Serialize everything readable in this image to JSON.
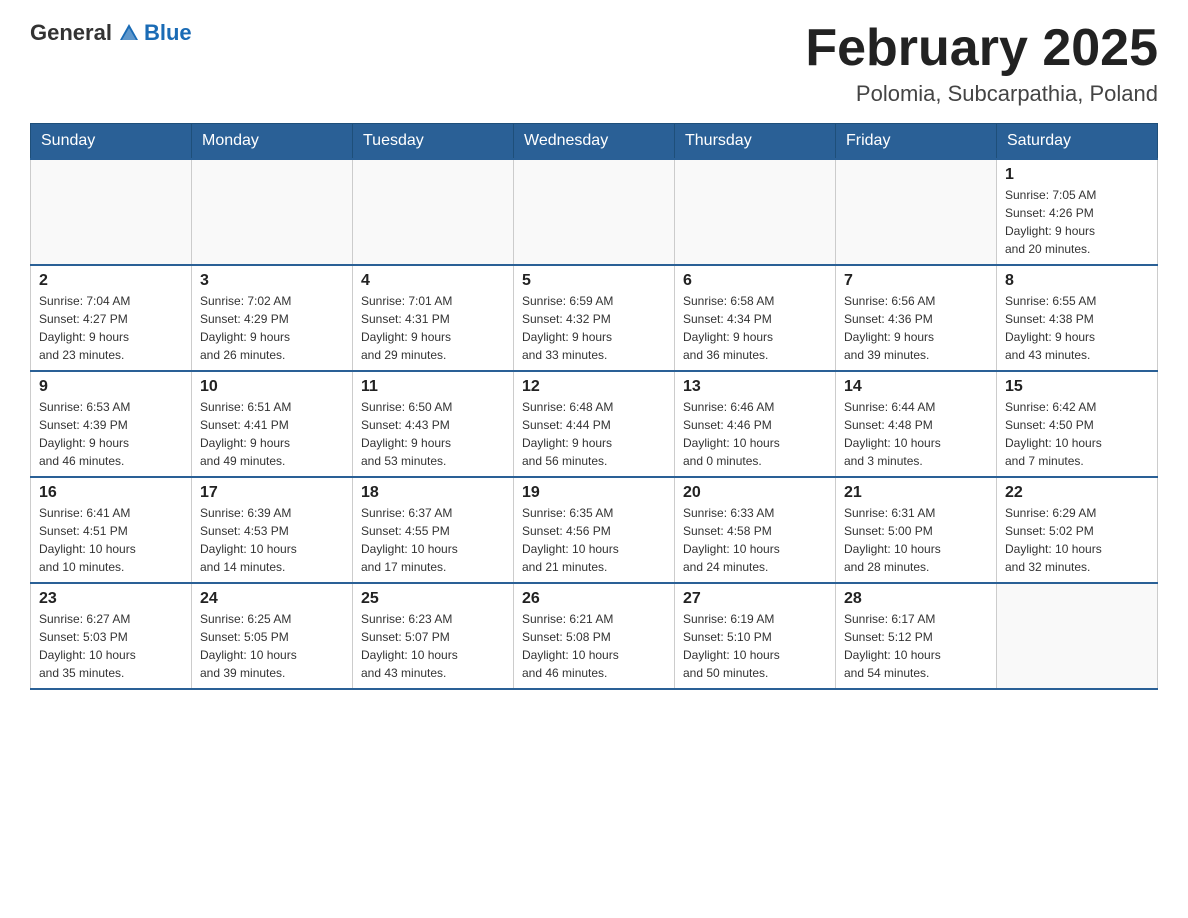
{
  "header": {
    "logo_general": "General",
    "logo_blue": "Blue",
    "month_title": "February 2025",
    "location": "Polomia, Subcarpathia, Poland"
  },
  "weekdays": [
    "Sunday",
    "Monday",
    "Tuesday",
    "Wednesday",
    "Thursday",
    "Friday",
    "Saturday"
  ],
  "weeks": [
    [
      {
        "day": "",
        "info": ""
      },
      {
        "day": "",
        "info": ""
      },
      {
        "day": "",
        "info": ""
      },
      {
        "day": "",
        "info": ""
      },
      {
        "day": "",
        "info": ""
      },
      {
        "day": "",
        "info": ""
      },
      {
        "day": "1",
        "info": "Sunrise: 7:05 AM\nSunset: 4:26 PM\nDaylight: 9 hours\nand 20 minutes."
      }
    ],
    [
      {
        "day": "2",
        "info": "Sunrise: 7:04 AM\nSunset: 4:27 PM\nDaylight: 9 hours\nand 23 minutes."
      },
      {
        "day": "3",
        "info": "Sunrise: 7:02 AM\nSunset: 4:29 PM\nDaylight: 9 hours\nand 26 minutes."
      },
      {
        "day": "4",
        "info": "Sunrise: 7:01 AM\nSunset: 4:31 PM\nDaylight: 9 hours\nand 29 minutes."
      },
      {
        "day": "5",
        "info": "Sunrise: 6:59 AM\nSunset: 4:32 PM\nDaylight: 9 hours\nand 33 minutes."
      },
      {
        "day": "6",
        "info": "Sunrise: 6:58 AM\nSunset: 4:34 PM\nDaylight: 9 hours\nand 36 minutes."
      },
      {
        "day": "7",
        "info": "Sunrise: 6:56 AM\nSunset: 4:36 PM\nDaylight: 9 hours\nand 39 minutes."
      },
      {
        "day": "8",
        "info": "Sunrise: 6:55 AM\nSunset: 4:38 PM\nDaylight: 9 hours\nand 43 minutes."
      }
    ],
    [
      {
        "day": "9",
        "info": "Sunrise: 6:53 AM\nSunset: 4:39 PM\nDaylight: 9 hours\nand 46 minutes."
      },
      {
        "day": "10",
        "info": "Sunrise: 6:51 AM\nSunset: 4:41 PM\nDaylight: 9 hours\nand 49 minutes."
      },
      {
        "day": "11",
        "info": "Sunrise: 6:50 AM\nSunset: 4:43 PM\nDaylight: 9 hours\nand 53 minutes."
      },
      {
        "day": "12",
        "info": "Sunrise: 6:48 AM\nSunset: 4:44 PM\nDaylight: 9 hours\nand 56 minutes."
      },
      {
        "day": "13",
        "info": "Sunrise: 6:46 AM\nSunset: 4:46 PM\nDaylight: 10 hours\nand 0 minutes."
      },
      {
        "day": "14",
        "info": "Sunrise: 6:44 AM\nSunset: 4:48 PM\nDaylight: 10 hours\nand 3 minutes."
      },
      {
        "day": "15",
        "info": "Sunrise: 6:42 AM\nSunset: 4:50 PM\nDaylight: 10 hours\nand 7 minutes."
      }
    ],
    [
      {
        "day": "16",
        "info": "Sunrise: 6:41 AM\nSunset: 4:51 PM\nDaylight: 10 hours\nand 10 minutes."
      },
      {
        "day": "17",
        "info": "Sunrise: 6:39 AM\nSunset: 4:53 PM\nDaylight: 10 hours\nand 14 minutes."
      },
      {
        "day": "18",
        "info": "Sunrise: 6:37 AM\nSunset: 4:55 PM\nDaylight: 10 hours\nand 17 minutes."
      },
      {
        "day": "19",
        "info": "Sunrise: 6:35 AM\nSunset: 4:56 PM\nDaylight: 10 hours\nand 21 minutes."
      },
      {
        "day": "20",
        "info": "Sunrise: 6:33 AM\nSunset: 4:58 PM\nDaylight: 10 hours\nand 24 minutes."
      },
      {
        "day": "21",
        "info": "Sunrise: 6:31 AM\nSunset: 5:00 PM\nDaylight: 10 hours\nand 28 minutes."
      },
      {
        "day": "22",
        "info": "Sunrise: 6:29 AM\nSunset: 5:02 PM\nDaylight: 10 hours\nand 32 minutes."
      }
    ],
    [
      {
        "day": "23",
        "info": "Sunrise: 6:27 AM\nSunset: 5:03 PM\nDaylight: 10 hours\nand 35 minutes."
      },
      {
        "day": "24",
        "info": "Sunrise: 6:25 AM\nSunset: 5:05 PM\nDaylight: 10 hours\nand 39 minutes."
      },
      {
        "day": "25",
        "info": "Sunrise: 6:23 AM\nSunset: 5:07 PM\nDaylight: 10 hours\nand 43 minutes."
      },
      {
        "day": "26",
        "info": "Sunrise: 6:21 AM\nSunset: 5:08 PM\nDaylight: 10 hours\nand 46 minutes."
      },
      {
        "day": "27",
        "info": "Sunrise: 6:19 AM\nSunset: 5:10 PM\nDaylight: 10 hours\nand 50 minutes."
      },
      {
        "day": "28",
        "info": "Sunrise: 6:17 AM\nSunset: 5:12 PM\nDaylight: 10 hours\nand 54 minutes."
      },
      {
        "day": "",
        "info": ""
      }
    ]
  ]
}
